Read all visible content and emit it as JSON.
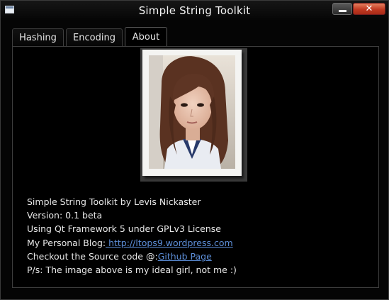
{
  "window": {
    "title": "Simple String Toolkit",
    "close_glyph": "✕",
    "icons": {
      "app": "app-window-icon",
      "minimize": "minimize-icon",
      "close": "close-icon"
    },
    "accent_color": "#5d8fd9",
    "close_color": "#c23a22"
  },
  "tabs": [
    {
      "label": "Hashing"
    },
    {
      "label": "Encoding"
    },
    {
      "label": "About",
      "selected": true
    }
  ],
  "about": {
    "photo": "portrait-photo",
    "line1": "Simple String Toolkit by Levis Nickaster",
    "line2": "Version: 0.1 beta",
    "line3": "Using Qt Framework 5 under GPLv3 License",
    "blog_prefix": "My Personal Blog:",
    "blog_link": " http://ltops9.wordpress.com",
    "source_prefix": "Checkout the Source code @:",
    "source_link": "Github Page",
    "line6": "P/s: The image above is my ideal girl, not me :)"
  }
}
